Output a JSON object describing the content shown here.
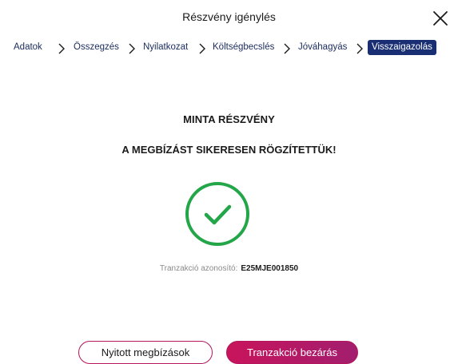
{
  "header": {
    "title": "Részvény igénylés",
    "close_icon": "close-icon"
  },
  "stepper": {
    "steps": [
      {
        "label": "Adatok",
        "active": false
      },
      {
        "label": "Összegzés",
        "active": false
      },
      {
        "label": "Nyilatkozat",
        "active": false
      },
      {
        "label": "Költségbecslés",
        "active": false
      },
      {
        "label": "Jóváhagyás",
        "active": false
      },
      {
        "label": "Visszaigazolás",
        "active": true
      }
    ],
    "separator_icon": "chevron-right-icon",
    "active_color": "#1a2f73"
  },
  "main": {
    "title": "MINTA RÉSZVÉNY",
    "success_message": "A MEGBÍZÁST SIKERESEN RÖGZÍTETTÜK!",
    "status_icon": "check-circle-icon",
    "status_color": "#22a648",
    "transaction_label": "Tranzakció azonosító:",
    "transaction_id": "E25MJE001850"
  },
  "actions": {
    "open_orders_label": "Nyitott megbízások",
    "close_transaction_label": "Tranzakció bezárás",
    "accent_color": "#b3165c"
  }
}
